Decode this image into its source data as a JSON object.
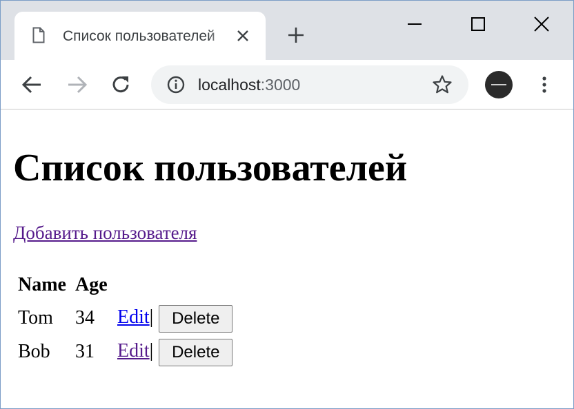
{
  "browser": {
    "tab_title": "Список пользователей",
    "url_host": "localhost",
    "url_port": ":3000"
  },
  "page": {
    "heading": "Список пользователей",
    "add_link": "Добавить пользователя",
    "table": {
      "headers": [
        "Name",
        "Age"
      ],
      "rows": [
        {
          "name": "Tom",
          "age": "34",
          "edit": "Edit",
          "separator": "|",
          "delete": "Delete"
        },
        {
          "name": "Bob",
          "age": "31",
          "edit": "Edit",
          "separator": "|",
          "delete": "Delete"
        }
      ]
    }
  }
}
